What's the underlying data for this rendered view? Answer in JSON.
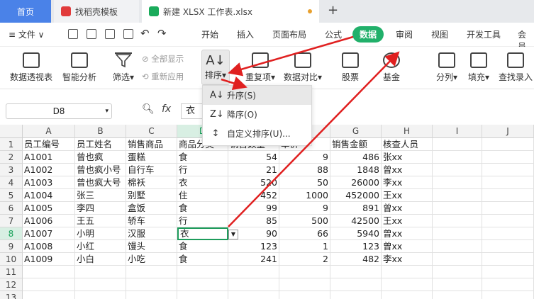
{
  "tabs": {
    "home": "首页",
    "doc1": "找稻壳模板",
    "doc2": "新建 XLSX 工作表.xlsx",
    "plus": "+"
  },
  "menu": {
    "file": "≡ 文件 ∨",
    "items": [
      "开始",
      "插入",
      "页面布局",
      "公式",
      "数据",
      "审阅",
      "视图",
      "开发工具",
      "会员"
    ]
  },
  "ribbon": {
    "pivot": "数据透视表",
    "smart": "智能分析",
    "filter": "筛选",
    "show_all": "全部显示",
    "reapply": "重新应用",
    "sort": "排序",
    "duplicates": "重复项",
    "compare": "数据对比",
    "stock": "股票",
    "fund": "基金",
    "split": "分列",
    "fill": "填充",
    "lookup": "查找录入"
  },
  "sort_menu": {
    "asc": "升序(S)",
    "desc": "降序(O)",
    "custom": "自定义排序(U)..."
  },
  "formula_bar": {
    "cell_ref": "D8",
    "fx": "fx",
    "value": "衣"
  },
  "columns": [
    "A",
    "B",
    "C",
    "D",
    "E",
    "F",
    "G",
    "H",
    "I",
    "J"
  ],
  "rows": [
    "1",
    "2",
    "3",
    "4",
    "5",
    "6",
    "7",
    "8",
    "9",
    "10",
    "11",
    "12",
    "13"
  ],
  "table": [
    [
      "员工编号",
      "员工姓名",
      "销售商品",
      "商品分类",
      "销售数量",
      "单价",
      "销售金额",
      "核查人员"
    ],
    [
      "A1001",
      "曾也疯",
      "蛋糕",
      "食",
      "54",
      "9",
      "486",
      "张xx"
    ],
    [
      "A1002",
      "曾也疯小号",
      "自行车",
      "行",
      "21",
      "88",
      "1848",
      "曾xx"
    ],
    [
      "A1003",
      "曾也疯大号",
      "棉袄",
      "衣",
      "520",
      "50",
      "26000",
      "李xx"
    ],
    [
      "A1004",
      "张三",
      "别墅",
      "住",
      "452",
      "1000",
      "452000",
      "王xx"
    ],
    [
      "A1005",
      "李四",
      "盒饭",
      "食",
      "99",
      "9",
      "891",
      "曾xx"
    ],
    [
      "A1006",
      "王五",
      "轿车",
      "行",
      "85",
      "500",
      "42500",
      "王xx"
    ],
    [
      "A1007",
      "小明",
      "汉服",
      "衣",
      "90",
      "66",
      "5940",
      "曾xx"
    ],
    [
      "A1008",
      "小红",
      "馒头",
      "食",
      "123",
      "1",
      "123",
      "曾xx"
    ],
    [
      "A1009",
      "小白",
      "小吃",
      "食",
      "241",
      "2",
      "482",
      "李xx"
    ]
  ],
  "colors": {
    "accent": "#21b06a",
    "arrow": "#e02020",
    "home_tab": "#4a82e8"
  }
}
